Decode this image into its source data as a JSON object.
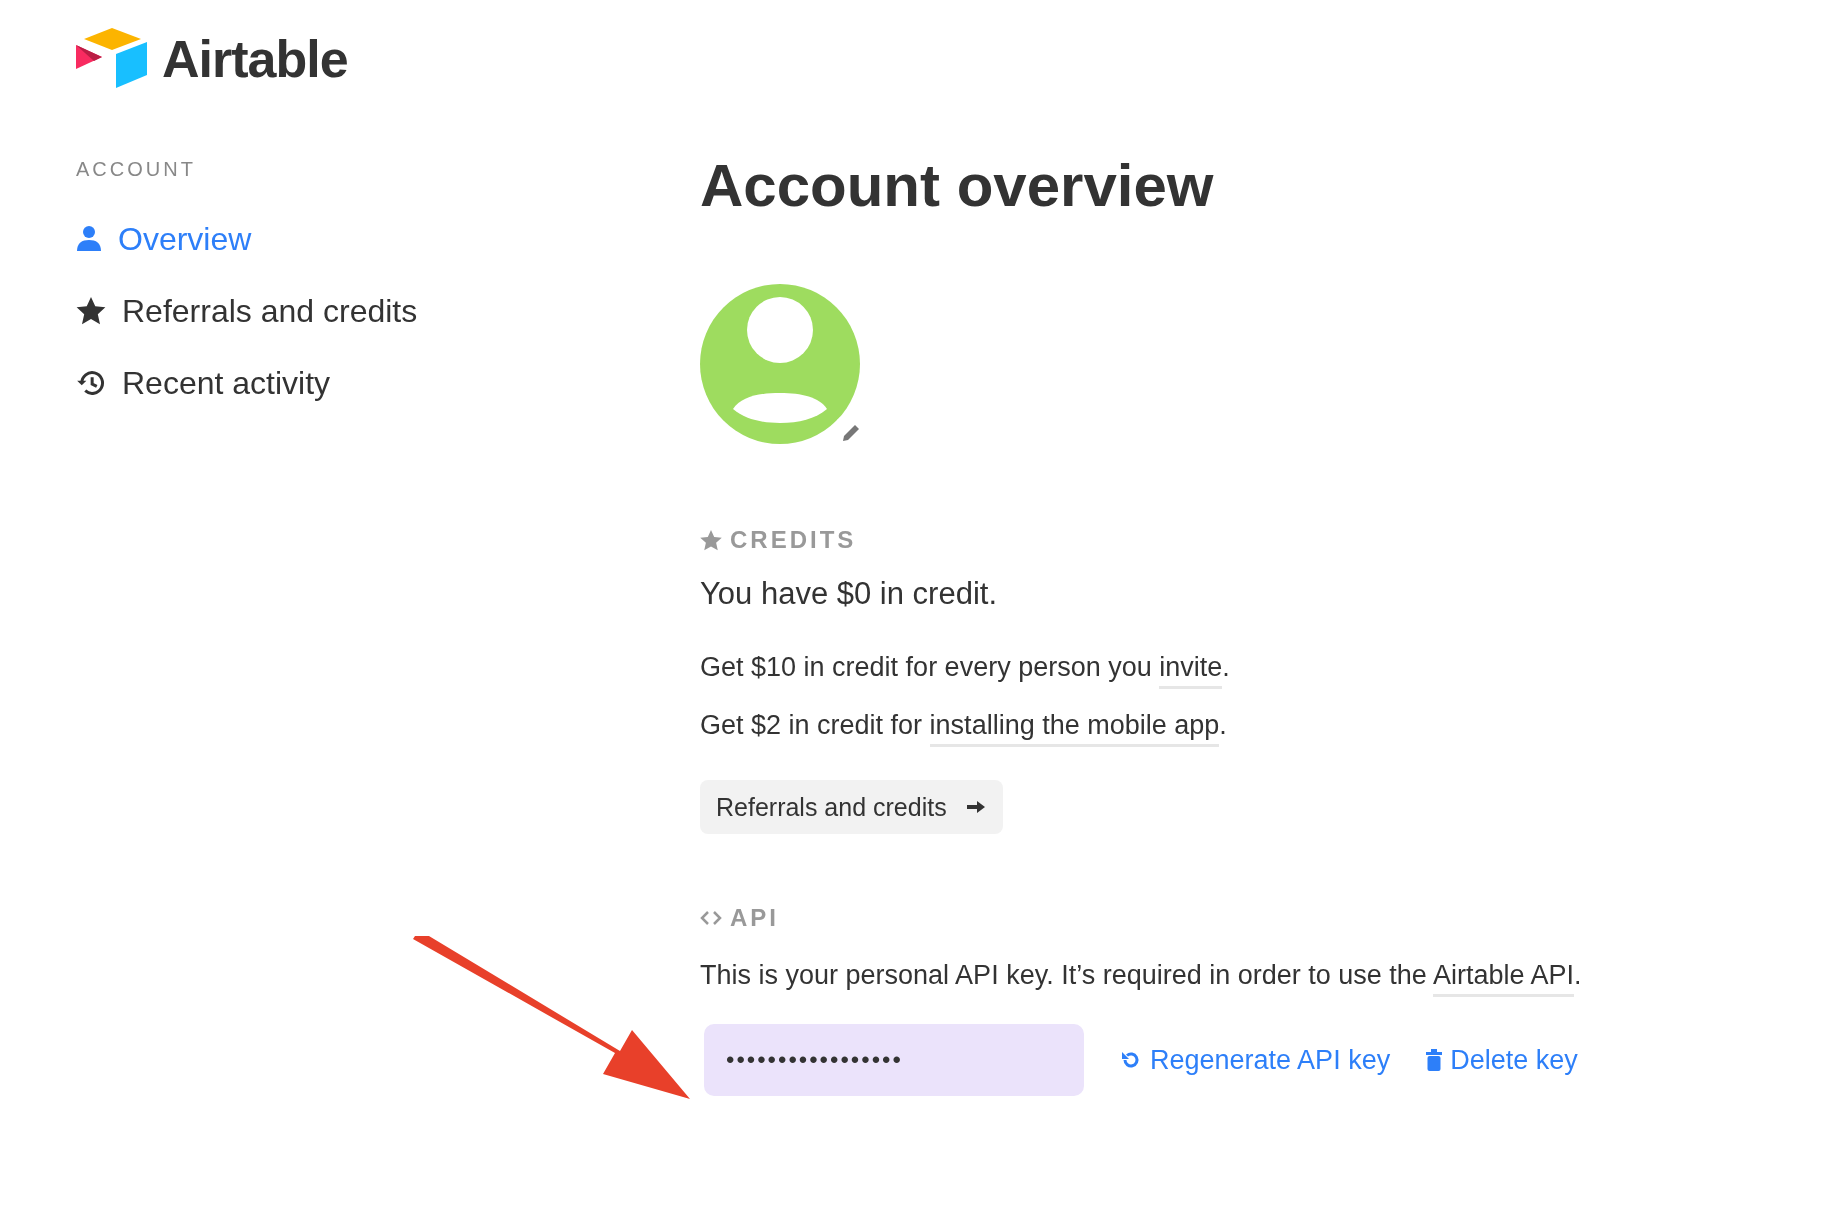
{
  "logo": {
    "text": "Airtable"
  },
  "sidebar": {
    "heading": "ACCOUNT",
    "items": [
      {
        "kind": "person",
        "label": "Overview",
        "selected": true
      },
      {
        "kind": "star",
        "label": "Referrals and credits",
        "selected": false
      },
      {
        "kind": "history",
        "label": "Recent activity",
        "selected": false
      }
    ]
  },
  "page_title": "Account overview",
  "credits": {
    "heading": "CREDITS",
    "balance": "You have $0 in credit.",
    "offers": [
      {
        "before": "Get $10 in credit for every person you ",
        "link": "invite",
        "after": "."
      },
      {
        "before": "Get $2 in credit for ",
        "link": "installing the mobile app",
        "after": "."
      }
    ],
    "button": "Referrals and credits"
  },
  "api": {
    "heading": "API",
    "description": {
      "before": "This is your personal API key. It’s required in order to use the ",
      "link": "Airtable API",
      "after": "."
    },
    "key_value": "•••••••••••••••••",
    "actions": [
      {
        "kind": "regenerate",
        "label": "Regenerate API key"
      },
      {
        "kind": "delete",
        "label": "Delete key"
      }
    ]
  }
}
